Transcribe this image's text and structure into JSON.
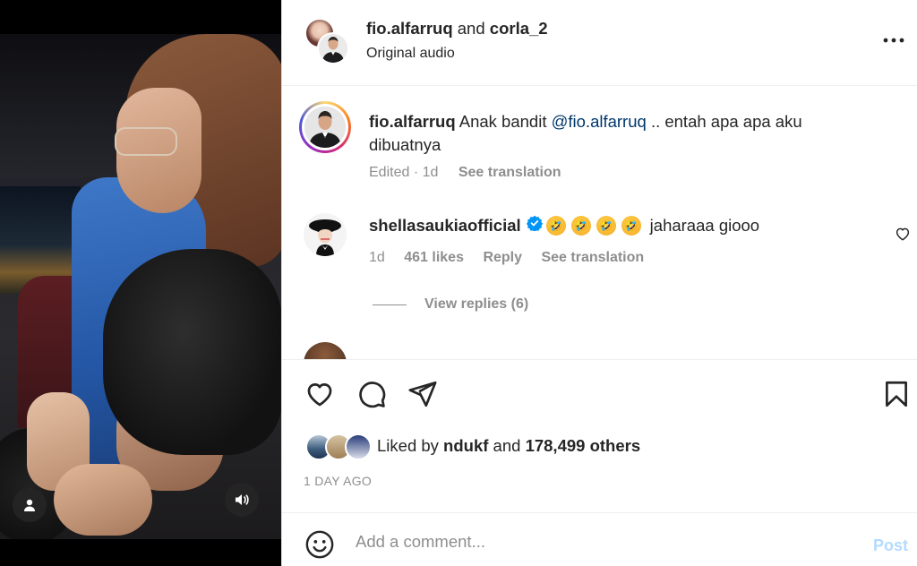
{
  "header": {
    "user1": "fio.alfarruq",
    "and_text": "and",
    "user2": "corla_2",
    "audio": "Original audio",
    "more_icon": "more-horizontal-icon"
  },
  "caption": {
    "username": "fio.alfarruq",
    "text_before": "Anak bandit",
    "mention": "@fio.alfarruq",
    "text_after": ".. entah apa apa aku dibuatnya",
    "edited": "Edited · 1d",
    "see_translation": "See translation"
  },
  "comment": {
    "username": "shellasaukiaofficial",
    "emojis": [
      "🤣",
      "🤣",
      "🤣",
      "🤣"
    ],
    "text": "jaharaaa giooo",
    "age": "1d",
    "likes": "461 likes",
    "reply": "Reply",
    "see_translation": "See translation",
    "view_replies": "View replies (6)"
  },
  "actions": {
    "liked_by_prefix": "Liked by",
    "liked_by_user": "ndukf",
    "liked_by_and": "and",
    "liked_by_others": "178,499 others",
    "date": "1 DAY AGO"
  },
  "composer": {
    "placeholder": "Add a comment...",
    "post_label": "Post"
  },
  "colors": {
    "text": "#262626",
    "secondary": "#8e8e8e",
    "mention": "#00376b",
    "verified": "#0095f6",
    "post_disabled": "#b3dbff"
  }
}
